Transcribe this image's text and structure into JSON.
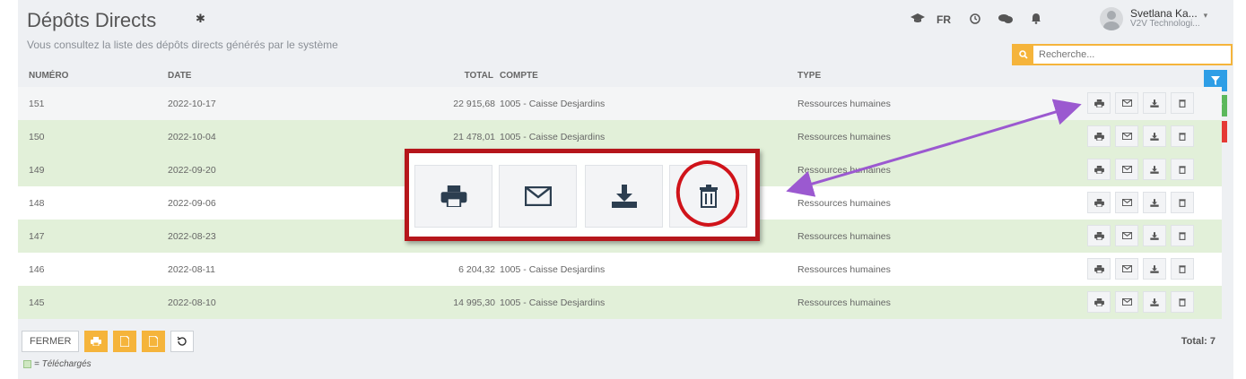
{
  "header": {
    "title": "Dépôts Directs",
    "subtitle": "Vous consultez la liste des dépôts directs générés par le système",
    "gear_icon": "gear-icon"
  },
  "topnav": {
    "lang": "FR",
    "icons": [
      "graduation-cap-icon",
      "clock-icon",
      "chat-icon",
      "bell-icon"
    ]
  },
  "user": {
    "name": "Svetlana Ka...",
    "company": "V2V Technologi..."
  },
  "search": {
    "placeholder": "Recherche..."
  },
  "side_tabs": {
    "filter": {
      "icon": "filter-icon",
      "color": "#2e9ee6"
    },
    "learn": {
      "icon": "graduation-cap-icon",
      "color": "#5cb85c"
    },
    "help": {
      "label": "?",
      "color": "#e53935"
    }
  },
  "table": {
    "columns": {
      "numero": "NUMÉRO",
      "date": "DATE",
      "total": "TOTAL",
      "compte": "COMPTE",
      "type": "TYPE"
    },
    "rows": [
      {
        "numero": "151",
        "date": "2022-10-17",
        "total": "22 915,68",
        "compte": "1005 - Caisse Desjardins",
        "type": "Ressources humaines",
        "style": "gray"
      },
      {
        "numero": "150",
        "date": "2022-10-04",
        "total": "21 478,01",
        "compte": "1005 - Caisse Desjardins",
        "type": "Ressources humaines",
        "style": "green"
      },
      {
        "numero": "149",
        "date": "2022-09-20",
        "total": "",
        "compte": "",
        "type": "Ressources humaines",
        "style": "green"
      },
      {
        "numero": "148",
        "date": "2022-09-06",
        "total": "",
        "compte": "",
        "type": "Ressources humaines",
        "style": "white"
      },
      {
        "numero": "147",
        "date": "2022-08-23",
        "total": "",
        "compte": "",
        "type": "Ressources humaines",
        "style": "green"
      },
      {
        "numero": "146",
        "date": "2022-08-11",
        "total": "6 204,32",
        "compte": "1005 - Caisse Desjardins",
        "type": "Ressources humaines",
        "style": "white"
      },
      {
        "numero": "145",
        "date": "2022-08-10",
        "total": "14 995,30",
        "compte": "1005 - Caisse Desjardins",
        "type": "Ressources humaines",
        "style": "green"
      }
    ],
    "row_actions": [
      "print-icon",
      "envelope-icon",
      "download-icon",
      "trash-icon"
    ]
  },
  "footer": {
    "close_label": "FERMER",
    "total_label": "Total: 7",
    "legend_label": "= Téléchargés",
    "buttons": [
      "print-icon",
      "pdf-icon",
      "pdf-icon",
      "history-icon"
    ]
  },
  "colors": {
    "accent_orange": "#f5b43b",
    "row_green": "#e2f0d9",
    "callout_red": "#b5161b",
    "arrow_purple": "#9b59d0"
  }
}
